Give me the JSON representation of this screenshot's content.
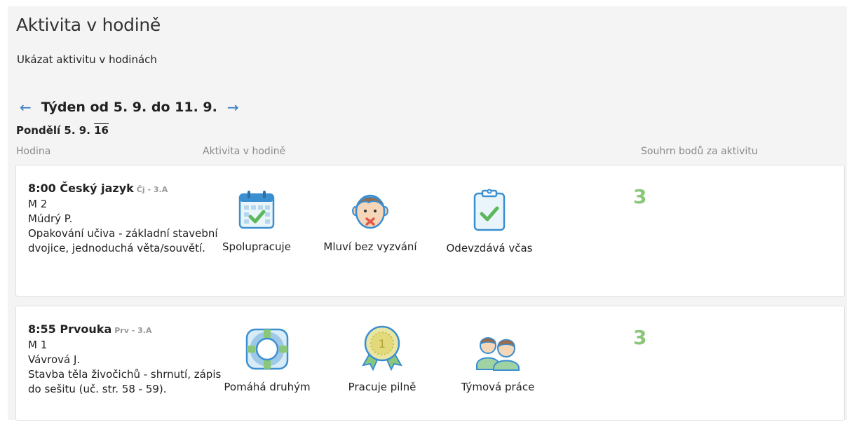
{
  "title": "Aktivita v hodině",
  "show_link": "Ukázat aktivitu v hodinách",
  "week": {
    "prev_arrow": "←",
    "label": "Týden od 5. 9. do 11. 9.",
    "next_arrow": "→"
  },
  "day": {
    "label": "Pondělí 5. 9.",
    "year": "16"
  },
  "columns": {
    "lesson": "Hodina",
    "activity": "Aktivita v hodině",
    "summary": "Souhrn bodů za aktivitu"
  },
  "lessons": [
    {
      "time_subject": "8:00 Český jazyk",
      "code": "Čj - 3.A",
      "room": "M 2",
      "teacher": "Múdrý P.",
      "topic": "Opakování učiva - základní stavební dvojice, jednoduchá věta/souvětí.",
      "activities": [
        {
          "label": "Spolupracuje",
          "icon": "calendar-check-icon"
        },
        {
          "label": "Mluví bez vyzvání",
          "icon": "face-mouth-x-icon"
        },
        {
          "label": "Odevzdává včas",
          "icon": "clipboard-check-icon"
        }
      ],
      "score": "3"
    },
    {
      "time_subject": "8:55 Prvouka",
      "code": "Prv - 3.A",
      "room": "M 1",
      "teacher": "Vávrová J.",
      "topic": "Stavba těla živočichů - shrnutí, zápis do sešitu (uč. str. 58 - 59).",
      "activities": [
        {
          "label": "Pomáhá druhým",
          "icon": "lifebuoy-icon"
        },
        {
          "label": "Pracuje pilně",
          "icon": "medal-icon"
        },
        {
          "label": "Týmová práce",
          "icon": "team-icon"
        }
      ],
      "score": "3"
    }
  ],
  "colors": {
    "icon_blue": "#3a8fd0",
    "icon_light": "#d8ecf8",
    "check_green": "#5cb85c",
    "score_green": "#8bc77a",
    "arrow_blue": "#3a7ec0"
  }
}
